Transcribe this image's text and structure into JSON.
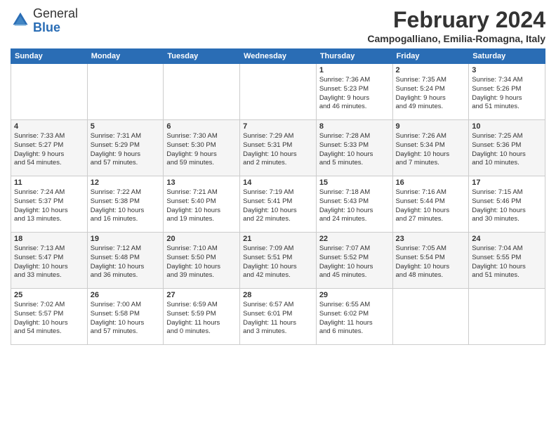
{
  "header": {
    "logo_line1": "General",
    "logo_line2": "Blue",
    "month_title": "February 2024",
    "location": "Campogalliano, Emilia-Romagna, Italy"
  },
  "days_of_week": [
    "Sunday",
    "Monday",
    "Tuesday",
    "Wednesday",
    "Thursday",
    "Friday",
    "Saturday"
  ],
  "weeks": [
    [
      {
        "day": "",
        "info": ""
      },
      {
        "day": "",
        "info": ""
      },
      {
        "day": "",
        "info": ""
      },
      {
        "day": "",
        "info": ""
      },
      {
        "day": "1",
        "info": "Sunrise: 7:36 AM\nSunset: 5:23 PM\nDaylight: 9 hours\nand 46 minutes."
      },
      {
        "day": "2",
        "info": "Sunrise: 7:35 AM\nSunset: 5:24 PM\nDaylight: 9 hours\nand 49 minutes."
      },
      {
        "day": "3",
        "info": "Sunrise: 7:34 AM\nSunset: 5:26 PM\nDaylight: 9 hours\nand 51 minutes."
      }
    ],
    [
      {
        "day": "4",
        "info": "Sunrise: 7:33 AM\nSunset: 5:27 PM\nDaylight: 9 hours\nand 54 minutes."
      },
      {
        "day": "5",
        "info": "Sunrise: 7:31 AM\nSunset: 5:29 PM\nDaylight: 9 hours\nand 57 minutes."
      },
      {
        "day": "6",
        "info": "Sunrise: 7:30 AM\nSunset: 5:30 PM\nDaylight: 9 hours\nand 59 minutes."
      },
      {
        "day": "7",
        "info": "Sunrise: 7:29 AM\nSunset: 5:31 PM\nDaylight: 10 hours\nand 2 minutes."
      },
      {
        "day": "8",
        "info": "Sunrise: 7:28 AM\nSunset: 5:33 PM\nDaylight: 10 hours\nand 5 minutes."
      },
      {
        "day": "9",
        "info": "Sunrise: 7:26 AM\nSunset: 5:34 PM\nDaylight: 10 hours\nand 7 minutes."
      },
      {
        "day": "10",
        "info": "Sunrise: 7:25 AM\nSunset: 5:36 PM\nDaylight: 10 hours\nand 10 minutes."
      }
    ],
    [
      {
        "day": "11",
        "info": "Sunrise: 7:24 AM\nSunset: 5:37 PM\nDaylight: 10 hours\nand 13 minutes."
      },
      {
        "day": "12",
        "info": "Sunrise: 7:22 AM\nSunset: 5:38 PM\nDaylight: 10 hours\nand 16 minutes."
      },
      {
        "day": "13",
        "info": "Sunrise: 7:21 AM\nSunset: 5:40 PM\nDaylight: 10 hours\nand 19 minutes."
      },
      {
        "day": "14",
        "info": "Sunrise: 7:19 AM\nSunset: 5:41 PM\nDaylight: 10 hours\nand 22 minutes."
      },
      {
        "day": "15",
        "info": "Sunrise: 7:18 AM\nSunset: 5:43 PM\nDaylight: 10 hours\nand 24 minutes."
      },
      {
        "day": "16",
        "info": "Sunrise: 7:16 AM\nSunset: 5:44 PM\nDaylight: 10 hours\nand 27 minutes."
      },
      {
        "day": "17",
        "info": "Sunrise: 7:15 AM\nSunset: 5:46 PM\nDaylight: 10 hours\nand 30 minutes."
      }
    ],
    [
      {
        "day": "18",
        "info": "Sunrise: 7:13 AM\nSunset: 5:47 PM\nDaylight: 10 hours\nand 33 minutes."
      },
      {
        "day": "19",
        "info": "Sunrise: 7:12 AM\nSunset: 5:48 PM\nDaylight: 10 hours\nand 36 minutes."
      },
      {
        "day": "20",
        "info": "Sunrise: 7:10 AM\nSunset: 5:50 PM\nDaylight: 10 hours\nand 39 minutes."
      },
      {
        "day": "21",
        "info": "Sunrise: 7:09 AM\nSunset: 5:51 PM\nDaylight: 10 hours\nand 42 minutes."
      },
      {
        "day": "22",
        "info": "Sunrise: 7:07 AM\nSunset: 5:52 PM\nDaylight: 10 hours\nand 45 minutes."
      },
      {
        "day": "23",
        "info": "Sunrise: 7:05 AM\nSunset: 5:54 PM\nDaylight: 10 hours\nand 48 minutes."
      },
      {
        "day": "24",
        "info": "Sunrise: 7:04 AM\nSunset: 5:55 PM\nDaylight: 10 hours\nand 51 minutes."
      }
    ],
    [
      {
        "day": "25",
        "info": "Sunrise: 7:02 AM\nSunset: 5:57 PM\nDaylight: 10 hours\nand 54 minutes."
      },
      {
        "day": "26",
        "info": "Sunrise: 7:00 AM\nSunset: 5:58 PM\nDaylight: 10 hours\nand 57 minutes."
      },
      {
        "day": "27",
        "info": "Sunrise: 6:59 AM\nSunset: 5:59 PM\nDaylight: 11 hours\nand 0 minutes."
      },
      {
        "day": "28",
        "info": "Sunrise: 6:57 AM\nSunset: 6:01 PM\nDaylight: 11 hours\nand 3 minutes."
      },
      {
        "day": "29",
        "info": "Sunrise: 6:55 AM\nSunset: 6:02 PM\nDaylight: 11 hours\nand 6 minutes."
      },
      {
        "day": "",
        "info": ""
      },
      {
        "day": "",
        "info": ""
      }
    ]
  ]
}
